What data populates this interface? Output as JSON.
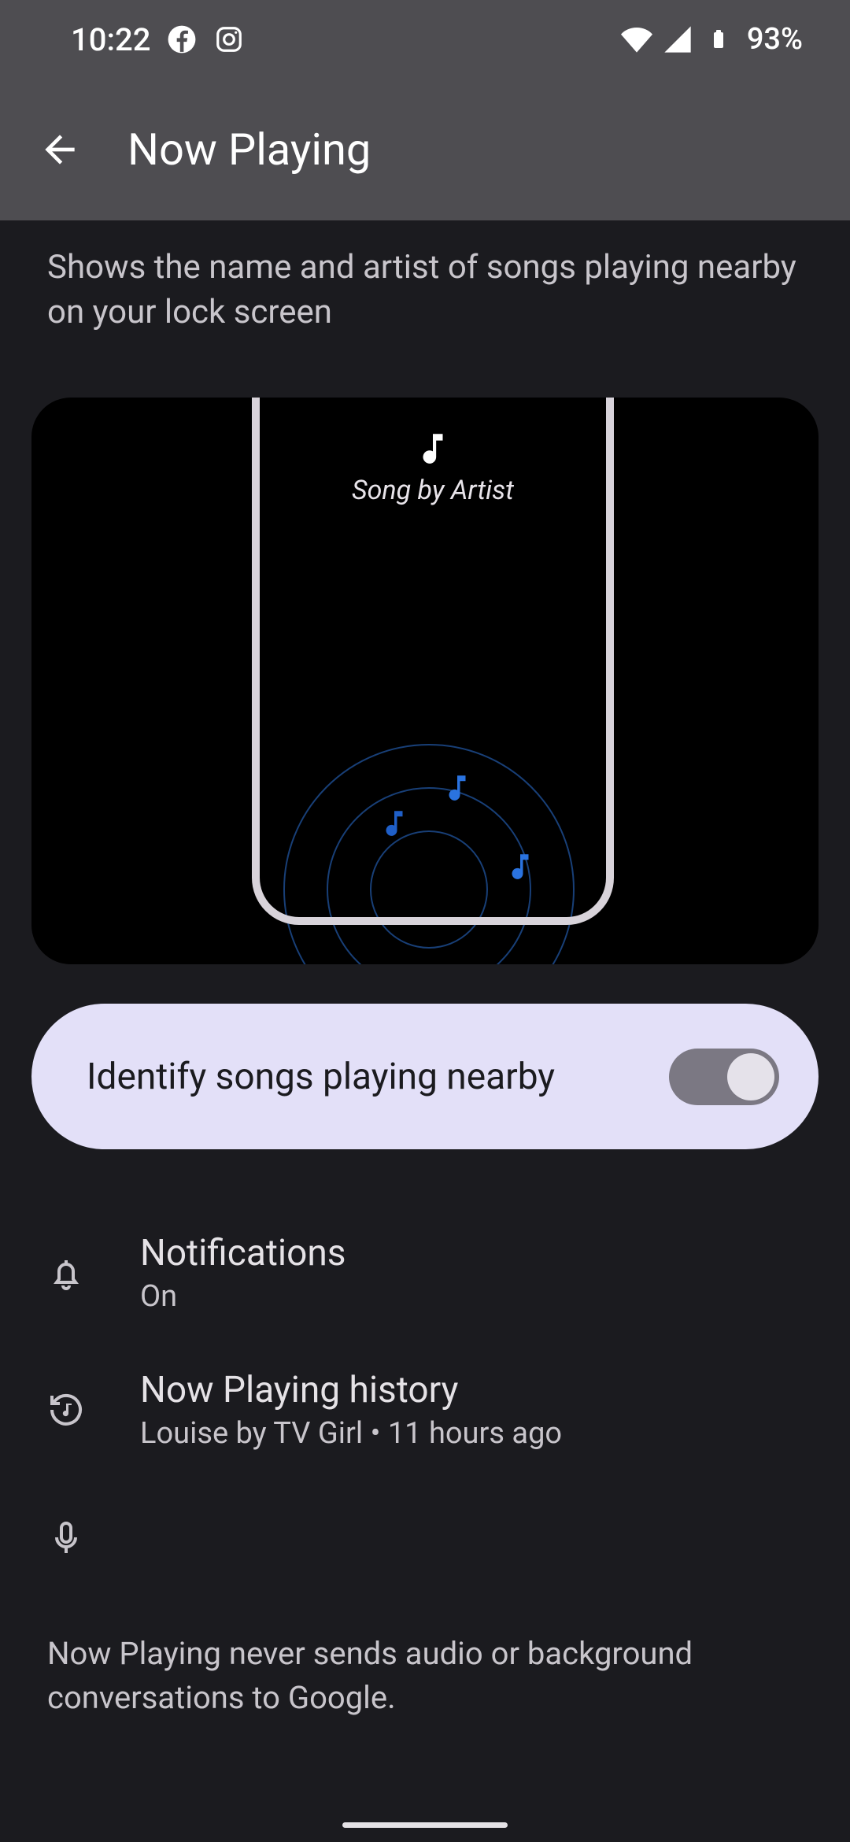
{
  "status": {
    "time": "10:22",
    "battery": "93%"
  },
  "header": {
    "title": "Now Playing"
  },
  "description": "Shows the name and artist of songs playing nearby on your lock screen",
  "illustration": {
    "song_label": "Song by Artist"
  },
  "toggle": {
    "label": "Identify songs playing nearby",
    "checked": true
  },
  "items": [
    {
      "title": "Notifications",
      "sub": "On",
      "icon": "bell"
    },
    {
      "title": "Now Playing history",
      "sub": "Louise by TV Girl • 11 hours ago",
      "icon": "history-music"
    },
    {
      "title": "",
      "sub": "",
      "icon": "mic"
    }
  ],
  "footer": "Now Playing never sends audio or background conversations to Google."
}
